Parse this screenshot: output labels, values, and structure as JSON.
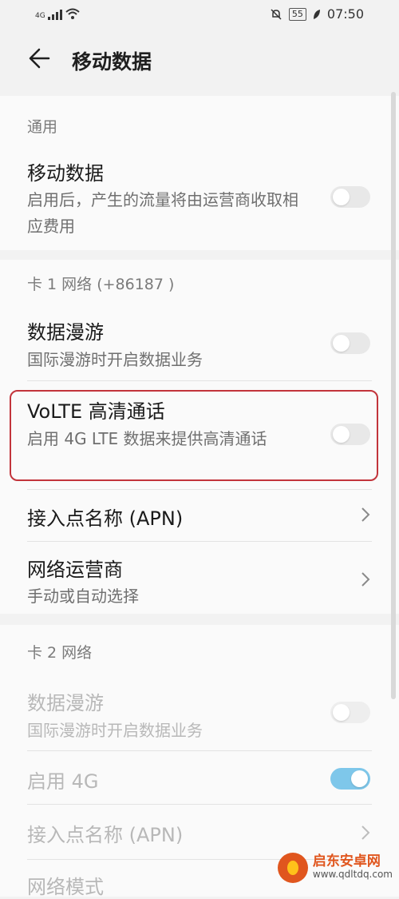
{
  "statusbar": {
    "network": "4G",
    "battery": "55",
    "time": "07:50",
    "icons": [
      "signal-icon",
      "wifi-icon",
      "mute-bell-icon",
      "battery-icon",
      "leaf-icon"
    ]
  },
  "header": {
    "title": "移动数据",
    "back_icon": "back-arrow-icon"
  },
  "general": {
    "section_label": "通用",
    "mobile_data": {
      "title": "移动数据",
      "subtitle": "启用后，产生的流量将由运营商收取相应费用",
      "enabled": false
    }
  },
  "sim1": {
    "section_label": "卡 1 网络 (+86187           )",
    "roaming": {
      "title": "数据漫游",
      "subtitle": "国际漫游时开启数据业务",
      "enabled": false
    },
    "volte": {
      "title": "VoLTE 高清通话",
      "subtitle": "启用 4G LTE 数据来提供高清通话",
      "enabled": false
    },
    "apn": {
      "title": "接入点名称 (APN)"
    },
    "carrier": {
      "title": "网络运营商",
      "subtitle": "手动或自动选择"
    }
  },
  "sim2": {
    "section_label": "卡 2 网络",
    "roaming": {
      "title": "数据漫游",
      "subtitle": "国际漫游时开启数据业务",
      "enabled": false
    },
    "enable_4g": {
      "title": "启用 4G",
      "enabled": true
    },
    "apn": {
      "title": "接入点名称 (APN)"
    },
    "network_mode": {
      "title": "网络模式"
    }
  },
  "watermark": {
    "name": "启东安卓网",
    "url": "www.qdltdq.com"
  },
  "colors": {
    "highlight": "#c2343b",
    "toggle_on": "#7ec7ea",
    "watermark": "#e0561e"
  }
}
